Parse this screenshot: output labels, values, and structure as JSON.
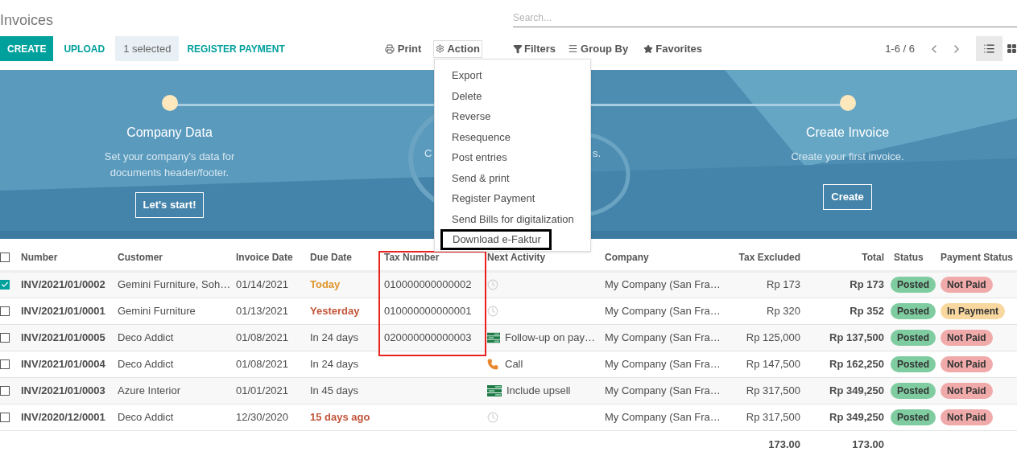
{
  "title": "Invoices",
  "search": {
    "placeholder": "Search..."
  },
  "toolbar": {
    "create": "CREATE",
    "upload": "UPLOAD",
    "selected_count": "1 selected",
    "register_payment": "REGISTER PAYMENT",
    "print": "Print",
    "action": "Action",
    "filters": "Filters",
    "group_by": "Group By",
    "favorites": "Favorites",
    "pager": "1-6 / 6"
  },
  "views": [
    {
      "kind": "list",
      "selected": true
    },
    {
      "kind": "kanban",
      "selected": false
    }
  ],
  "action_menu": [
    {
      "label": "Export",
      "outlined": false
    },
    {
      "label": "Delete",
      "outlined": false
    },
    {
      "label": "Reverse",
      "outlined": false
    },
    {
      "label": "Resequence",
      "outlined": false
    },
    {
      "label": "Post entries",
      "outlined": false
    },
    {
      "label": "Send & print",
      "outlined": false
    },
    {
      "label": "Register Payment",
      "outlined": false
    },
    {
      "label": "Send Bills for digitalization",
      "outlined": false
    },
    {
      "label": "Download e-Faktur",
      "outlined": true
    }
  ],
  "banner": {
    "steps": [
      {
        "title": "Company Data",
        "description": "Set your company's data for documents header/footer.",
        "button": "Let's start!"
      },
      {
        "fragment_left": "C",
        "fragment_right": "s."
      },
      {
        "title": "Create Invoice",
        "description": "Create your first invoice.",
        "button": "Create"
      }
    ]
  },
  "table": {
    "select_all": {
      "checked": false
    },
    "columns": [
      {
        "label": "Number",
        "outlined": false
      },
      {
        "label": "Customer",
        "outlined": false
      },
      {
        "label": "Invoice Date",
        "outlined": false
      },
      {
        "label": "Due Date",
        "outlined": false
      },
      {
        "label": "Tax Number",
        "outlined": true
      },
      {
        "label": "Next Activity",
        "outlined": false
      },
      {
        "label": "Company",
        "outlined": false
      },
      {
        "label": "Tax Excluded",
        "outlined": false
      },
      {
        "label": "Total",
        "outlined": false
      },
      {
        "label": "Status",
        "outlined": false
      },
      {
        "label": "Payment Status",
        "outlined": false
      }
    ],
    "rows": [
      {
        "checked": true,
        "number": "INV/2021/01/0002",
        "customer": "Gemini Furniture, Soh…",
        "invoice_date": "01/14/2021",
        "due_date": {
          "text": "Today",
          "kind": "today"
        },
        "tax_number": "010000000000002",
        "activity": {
          "kind": "none"
        },
        "company": "My Company (San Fra…",
        "tax_excluded": "Rp 173",
        "total": "Rp 173",
        "status": {
          "text": "Posted",
          "color": "#7fcca0"
        },
        "payment_status": {
          "text": "Not Paid",
          "color": "#f0aaaa"
        }
      },
      {
        "checked": false,
        "number": "INV/2021/01/0001",
        "customer": "Gemini Furniture",
        "invoice_date": "01/13/2021",
        "due_date": {
          "text": "Yesterday",
          "kind": "overdue"
        },
        "tax_number": "010000000000001",
        "activity": {
          "kind": "none"
        },
        "company": "My Company (San Fra…",
        "tax_excluded": "Rp 320",
        "total": "Rp 352",
        "status": {
          "text": "Posted",
          "color": "#7fcca0"
        },
        "payment_status": {
          "text": "In Payment",
          "color": "#f9d8a0"
        }
      },
      {
        "checked": false,
        "number": "INV/2021/01/0005",
        "customer": "Deco Addict",
        "invoice_date": "01/08/2021",
        "due_date": {
          "text": "In 24 days",
          "kind": "future"
        },
        "tax_number": "020000000000003",
        "activity": {
          "kind": "todo",
          "text": "Follow-up on pay…"
        },
        "company": "My Company (San Fra…",
        "tax_excluded": "Rp 125,000",
        "total": "Rp 137,500",
        "status": {
          "text": "Posted",
          "color": "#7fcca0"
        },
        "payment_status": {
          "text": "Not Paid",
          "color": "#f0aaaa"
        }
      },
      {
        "checked": false,
        "number": "INV/2021/01/0004",
        "customer": "Deco Addict",
        "invoice_date": "01/08/2021",
        "due_date": {
          "text": "In 24 days",
          "kind": "future"
        },
        "activity": {
          "kind": "call",
          "text": "Call"
        },
        "company": "My Company (San Fra…",
        "tax_excluded": "Rp 147,500",
        "total": "Rp 162,250",
        "status": {
          "text": "Posted",
          "color": "#7fcca0"
        },
        "payment_status": {
          "text": "Not Paid",
          "color": "#f0aaaa"
        }
      },
      {
        "checked": false,
        "number": "INV/2021/01/0003",
        "customer": "Azure Interior",
        "invoice_date": "01/01/2021",
        "due_date": {
          "text": "In 45 days",
          "kind": "future"
        },
        "activity": {
          "kind": "todo",
          "text": "Include upsell"
        },
        "company": "My Company (San Fra…",
        "tax_excluded": "Rp 317,500",
        "total": "Rp 349,250",
        "status": {
          "text": "Posted",
          "color": "#7fcca0"
        },
        "payment_status": {
          "text": "Not Paid",
          "color": "#f0aaaa"
        }
      },
      {
        "checked": false,
        "number": "INV/2020/12/0001",
        "customer": "Deco Addict",
        "invoice_date": "12/30/2020",
        "due_date": {
          "text": "15 days ago",
          "kind": "overdue"
        },
        "activity": {
          "kind": "none"
        },
        "company": "My Company (San Fra…",
        "tax_excluded": "Rp 317,500",
        "total": "Rp 349,250",
        "status": {
          "text": "Posted",
          "color": "#7fcca0"
        },
        "payment_status": {
          "text": "Not Paid",
          "color": "#f0aaaa"
        }
      }
    ],
    "totals": {
      "tax_excluded": "173.00",
      "total": "173.00"
    }
  }
}
